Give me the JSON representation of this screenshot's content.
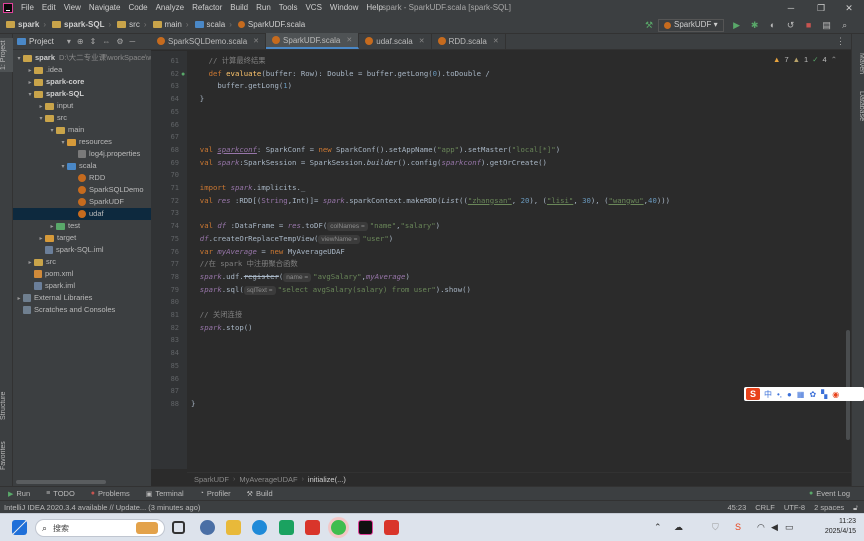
{
  "menubar": {
    "items": [
      "File",
      "Edit",
      "View",
      "Navigate",
      "Code",
      "Analyze",
      "Refactor",
      "Build",
      "Run",
      "Tools",
      "VCS",
      "Window",
      "Help"
    ],
    "window_title": "spark - SparkUDF.scala [spark-SQL]"
  },
  "breadcrumbs": [
    "spark",
    "spark-SQL",
    "src",
    "main",
    "scala",
    "SparkUDF.scala"
  ],
  "toolbar": {
    "run_config": "SparkUDF"
  },
  "side_tabs": {
    "project": "1: Project",
    "structure": "Structure",
    "favorites": "Favorites",
    "maven": "Maven",
    "database": "Database"
  },
  "project_panel": {
    "title": "Project",
    "tree": [
      {
        "label": "spark",
        "extra": "D:\\大二专业课\\workSpace\\wo",
        "indent": 0,
        "arrow": "▾",
        "icon": "folder",
        "bold": true
      },
      {
        "label": ".idea",
        "indent": 1,
        "arrow": "▸",
        "icon": "folder"
      },
      {
        "label": "spark-core",
        "indent": 1,
        "arrow": "▸",
        "icon": "folder",
        "bold": true
      },
      {
        "label": "spark-SQL",
        "indent": 1,
        "arrow": "▾",
        "icon": "folder",
        "bold": true
      },
      {
        "label": "input",
        "indent": 2,
        "arrow": "▸",
        "icon": "folder"
      },
      {
        "label": "src",
        "indent": 2,
        "arrow": "▾",
        "icon": "folder"
      },
      {
        "label": "main",
        "indent": 3,
        "arrow": "▾",
        "icon": "folder"
      },
      {
        "label": "resources",
        "indent": 4,
        "arrow": "▾",
        "icon": "folder-orange"
      },
      {
        "label": "log4j.properties",
        "indent": 5,
        "arrow": "",
        "icon": "file"
      },
      {
        "label": "scala",
        "indent": 4,
        "arrow": "▾",
        "icon": "folder-blue"
      },
      {
        "label": "RDD",
        "indent": 5,
        "arrow": "",
        "icon": "scala"
      },
      {
        "label": "SparkSQLDemo",
        "indent": 5,
        "arrow": "",
        "icon": "scala"
      },
      {
        "label": "SparkUDF",
        "indent": 5,
        "arrow": "",
        "icon": "scala"
      },
      {
        "label": "udaf",
        "indent": 5,
        "arrow": "",
        "icon": "scala",
        "selected": true
      },
      {
        "label": "test",
        "indent": 3,
        "arrow": "▸",
        "icon": "folder-green"
      },
      {
        "label": "target",
        "indent": 2,
        "arrow": "▸",
        "icon": "folder-orange"
      },
      {
        "label": "spark-SQL.iml",
        "indent": 2,
        "arrow": "",
        "icon": "iml"
      },
      {
        "label": "src",
        "indent": 1,
        "arrow": "▸",
        "icon": "folder"
      },
      {
        "label": "pom.xml",
        "indent": 1,
        "arrow": "",
        "icon": "xml"
      },
      {
        "label": "spark.iml",
        "indent": 1,
        "arrow": "",
        "icon": "iml"
      },
      {
        "label": "External Libraries",
        "indent": 0,
        "arrow": "▸",
        "icon": "lib"
      },
      {
        "label": "Scratches and Consoles",
        "indent": 0,
        "arrow": "",
        "icon": "lib"
      }
    ]
  },
  "editor_tabs": [
    {
      "label": "SparkSQLDemo.scala",
      "active": false
    },
    {
      "label": "SparkUDF.scala",
      "active": true
    },
    {
      "label": "udaf.scala",
      "active": false
    },
    {
      "label": "RDD.scala",
      "active": false
    }
  ],
  "inspections": {
    "warnings": "7",
    "weak": "1",
    "typos": "4"
  },
  "code": {
    "line_numbers": [
      "61",
      "62",
      "63",
      "64",
      "65",
      "66",
      "67",
      "68",
      "69",
      "70",
      "71",
      "72",
      "73",
      "74",
      "75",
      "76",
      "77",
      "78",
      "79",
      "80",
      "81",
      "82",
      "83",
      "84",
      "85",
      "86",
      "87",
      "88"
    ],
    "lines": [
      {
        "n": "61",
        "parts": [
          {
            "t": "    // 计算最终结果",
            "c": "cm"
          }
        ]
      },
      {
        "n": "62",
        "parts": [
          {
            "t": "    ",
            "c": ""
          },
          {
            "t": "def ",
            "c": "kw"
          },
          {
            "t": "evaluate",
            "c": "fn"
          },
          {
            "t": "(buffer: Row): Double = buffer.getLong(",
            "c": ""
          },
          {
            "t": "0",
            "c": "num"
          },
          {
            "t": ").toDouble /",
            "c": ""
          }
        ]
      },
      {
        "n": "63",
        "parts": [
          {
            "t": "      buffer.getLong(",
            "c": ""
          },
          {
            "t": "1",
            "c": "num"
          },
          {
            "t": ")",
            "c": ""
          }
        ]
      },
      {
        "n": "64",
        "parts": [
          {
            "t": "  }",
            "c": ""
          }
        ]
      },
      {
        "n": "65",
        "parts": []
      },
      {
        "n": "66",
        "parts": []
      },
      {
        "n": "67",
        "parts": []
      },
      {
        "n": "68",
        "parts": [
          {
            "t": "  ",
            "c": ""
          },
          {
            "t": "val ",
            "c": "kw"
          },
          {
            "t": "sparkconf",
            "c": "pu it ul"
          },
          {
            "t": ": SparkConf = ",
            "c": ""
          },
          {
            "t": "new ",
            "c": "kw"
          },
          {
            "t": "SparkConf().setAppName(",
            "c": ""
          },
          {
            "t": "\"app\"",
            "c": "str"
          },
          {
            "t": ").setMaster(",
            "c": ""
          },
          {
            "t": "\"local[*]\"",
            "c": "str"
          },
          {
            "t": ")",
            "c": ""
          }
        ]
      },
      {
        "n": "69",
        "parts": [
          {
            "t": "  ",
            "c": ""
          },
          {
            "t": "val ",
            "c": "kw"
          },
          {
            "t": "spark",
            "c": "pu it"
          },
          {
            "t": ":SparkSession = SparkSession.",
            "c": ""
          },
          {
            "t": "builder",
            "c": "it"
          },
          {
            "t": "().config(",
            "c": ""
          },
          {
            "t": "sparkconf",
            "c": "pu it"
          },
          {
            "t": ").getOrCreate()",
            "c": ""
          }
        ]
      },
      {
        "n": "70",
        "parts": []
      },
      {
        "n": "71",
        "parts": [
          {
            "t": "  ",
            "c": ""
          },
          {
            "t": "import ",
            "c": "kw"
          },
          {
            "t": "spark",
            "c": "pu it"
          },
          {
            "t": ".implicits._",
            "c": ""
          }
        ]
      },
      {
        "n": "72",
        "parts": [
          {
            "t": "  ",
            "c": ""
          },
          {
            "t": "val ",
            "c": "kw"
          },
          {
            "t": "res",
            "c": "pu it"
          },
          {
            "t": " :RDD[(",
            "c": ""
          },
          {
            "t": "String",
            "c": "pu"
          },
          {
            "t": ",Int)]= ",
            "c": ""
          },
          {
            "t": "spark",
            "c": "pu it"
          },
          {
            "t": ".sparkContext.makeRDD(",
            "c": ""
          },
          {
            "t": "List",
            "c": "it"
          },
          {
            "t": "((",
            "c": ""
          },
          {
            "t": "\"zhangsan\"",
            "c": "str ul"
          },
          {
            "t": ", ",
            "c": ""
          },
          {
            "t": "20",
            "c": "num"
          },
          {
            "t": "), (",
            "c": ""
          },
          {
            "t": "\"lisi\"",
            "c": "str ul"
          },
          {
            "t": ", ",
            "c": ""
          },
          {
            "t": "30",
            "c": "num"
          },
          {
            "t": "), (",
            "c": ""
          },
          {
            "t": "\"wangwu\"",
            "c": "str ul"
          },
          {
            "t": ",",
            "c": ""
          },
          {
            "t": "40",
            "c": "num"
          },
          {
            "t": ")))",
            "c": ""
          }
        ]
      },
      {
        "n": "73",
        "parts": []
      },
      {
        "n": "74",
        "parts": [
          {
            "t": "  ",
            "c": ""
          },
          {
            "t": "val ",
            "c": "kw"
          },
          {
            "t": "df",
            "c": "pu it"
          },
          {
            "t": " :DataFrame = ",
            "c": ""
          },
          {
            "t": "res",
            "c": "pu it"
          },
          {
            "t": ".toDF(",
            "c": ""
          },
          {
            "h": "colNames ="
          },
          {
            "t": "\"name\"",
            "c": "str"
          },
          {
            "t": ",",
            "c": ""
          },
          {
            "t": "\"salary\"",
            "c": "str"
          },
          {
            "t": ")",
            "c": ""
          }
        ]
      },
      {
        "n": "75",
        "parts": [
          {
            "t": "  ",
            "c": ""
          },
          {
            "t": "df",
            "c": "pu it"
          },
          {
            "t": ".createOrReplaceTempView(",
            "c": ""
          },
          {
            "h": "viewName ="
          },
          {
            "t": "\"user\"",
            "c": "str"
          },
          {
            "t": ")",
            "c": ""
          }
        ]
      },
      {
        "n": "76",
        "parts": [
          {
            "t": "  ",
            "c": ""
          },
          {
            "t": "var ",
            "c": "kw"
          },
          {
            "t": "myAverage",
            "c": "pu it"
          },
          {
            "t": " = ",
            "c": ""
          },
          {
            "t": "new ",
            "c": "kw"
          },
          {
            "t": "MyAverageUDAF",
            "c": ""
          }
        ]
      },
      {
        "n": "77",
        "parts": [
          {
            "t": "  //在 spark 中注册聚合函数",
            "c": "cm"
          }
        ]
      },
      {
        "n": "78",
        "parts": [
          {
            "t": "  ",
            "c": ""
          },
          {
            "t": "spark",
            "c": "pu it"
          },
          {
            "t": ".udf.",
            "c": ""
          },
          {
            "t": "register",
            "c": "st"
          },
          {
            "t": "(",
            "c": ""
          },
          {
            "h": "name ="
          },
          {
            "t": "\"avgSalary\"",
            "c": "str"
          },
          {
            "t": ",",
            "c": ""
          },
          {
            "t": "myAverage",
            "c": "pu it"
          },
          {
            "t": ")",
            "c": ""
          }
        ]
      },
      {
        "n": "79",
        "parts": [
          {
            "t": "  ",
            "c": ""
          },
          {
            "t": "spark",
            "c": "pu it"
          },
          {
            "t": ".sql(",
            "c": ""
          },
          {
            "h": "sqlText ="
          },
          {
            "t": "\"select avgSalary(salary) from user\"",
            "c": "str"
          },
          {
            "t": ").show()",
            "c": ""
          }
        ]
      },
      {
        "n": "80",
        "parts": []
      },
      {
        "n": "81",
        "parts": [
          {
            "t": "  // 关闭连接",
            "c": "cm"
          }
        ]
      },
      {
        "n": "82",
        "parts": [
          {
            "t": "  ",
            "c": ""
          },
          {
            "t": "spark",
            "c": "pu it"
          },
          {
            "t": ".stop()",
            "c": ""
          }
        ]
      },
      {
        "n": "83",
        "parts": []
      },
      {
        "n": "84",
        "parts": []
      },
      {
        "n": "85",
        "parts": []
      },
      {
        "n": "86",
        "parts": []
      },
      {
        "n": "87",
        "parts": []
      },
      {
        "n": "88",
        "parts": [
          {
            "t": "}",
            "c": ""
          }
        ]
      }
    ]
  },
  "code_breadcrumb": [
    "SparkUDF",
    "MyAverageUDAF",
    "initialize(...)"
  ],
  "tool_windows": [
    {
      "label": "Run",
      "glyph": "▶"
    },
    {
      "label": "TODO",
      "glyph": "≡"
    },
    {
      "label": "Problems",
      "glyph": "●"
    },
    {
      "label": "Terminal",
      "glyph": "▣"
    },
    {
      "label": "Profiler",
      "glyph": "◔"
    },
    {
      "label": "Build",
      "glyph": "⚒"
    }
  ],
  "event_log": "Event Log",
  "status": {
    "message": "IntelliJ IDEA 2020.3.4 available // Update... (3 minutes ago)",
    "position": "45:23",
    "line_sep": "CRLF",
    "encoding": "UTF-8",
    "indent": "2 spaces"
  },
  "ime_bar": {
    "label": "中"
  },
  "taskbar": {
    "search_placeholder": "搜索",
    "time": "11:23",
    "date": "2025/4/15"
  }
}
